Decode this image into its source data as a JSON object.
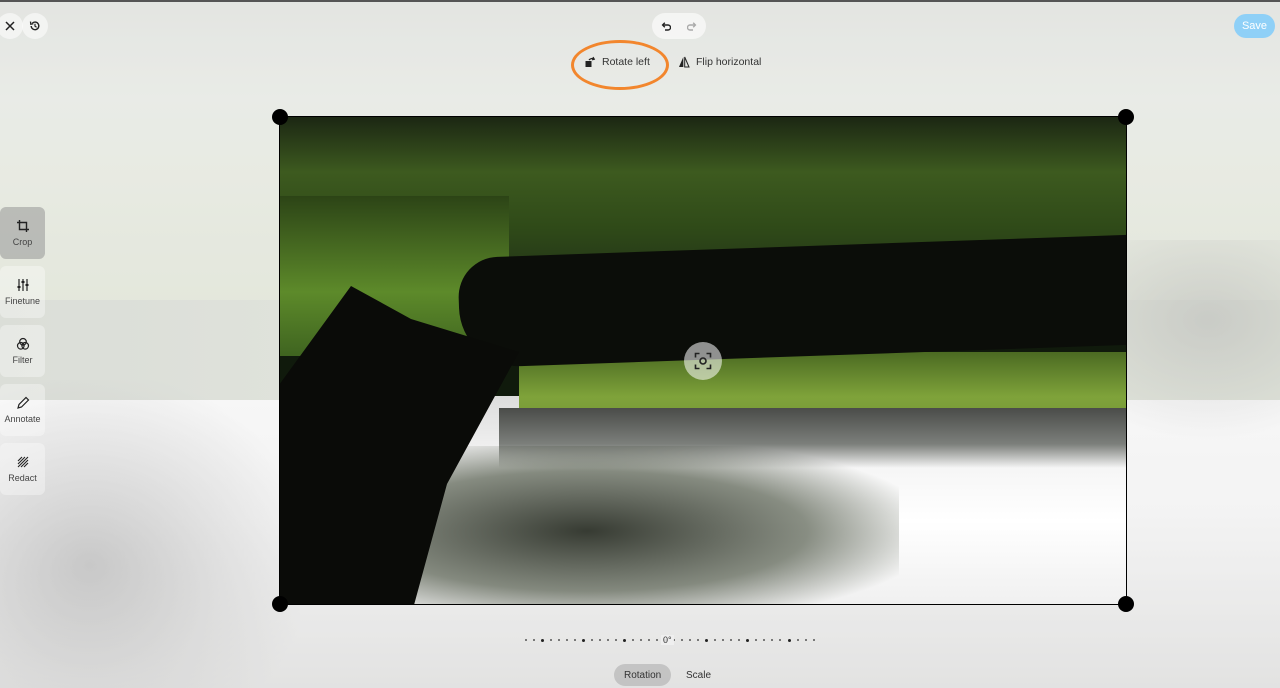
{
  "toolbar": {
    "close_icon": "close-icon",
    "revert_icon": "history-icon",
    "undo_icon": "undo-icon",
    "redo_icon": "redo-icon",
    "save_label": "Save",
    "save_color": "#8fd0f7"
  },
  "crop_actions": {
    "rotate_left_label": "Rotate left",
    "flip_horizontal_label": "Flip horizontal",
    "highlight_color": "#f2862d"
  },
  "sidebar": {
    "items": [
      {
        "label": "Crop",
        "icon": "crop-icon",
        "active": true
      },
      {
        "label": "Finetune",
        "icon": "sliders-icon",
        "active": false
      },
      {
        "label": "Filter",
        "icon": "filter-circles-icon",
        "active": false
      },
      {
        "label": "Annotate",
        "icon": "pencil-icon",
        "active": false
      },
      {
        "label": "Redact",
        "icon": "redact-hatch-icon",
        "active": false
      }
    ]
  },
  "canvas": {
    "recenter_icon": "recenter-icon"
  },
  "rotation": {
    "value": "0°"
  },
  "tabs": [
    {
      "label": "Rotation",
      "active": true
    },
    {
      "label": "Scale",
      "active": false
    }
  ]
}
